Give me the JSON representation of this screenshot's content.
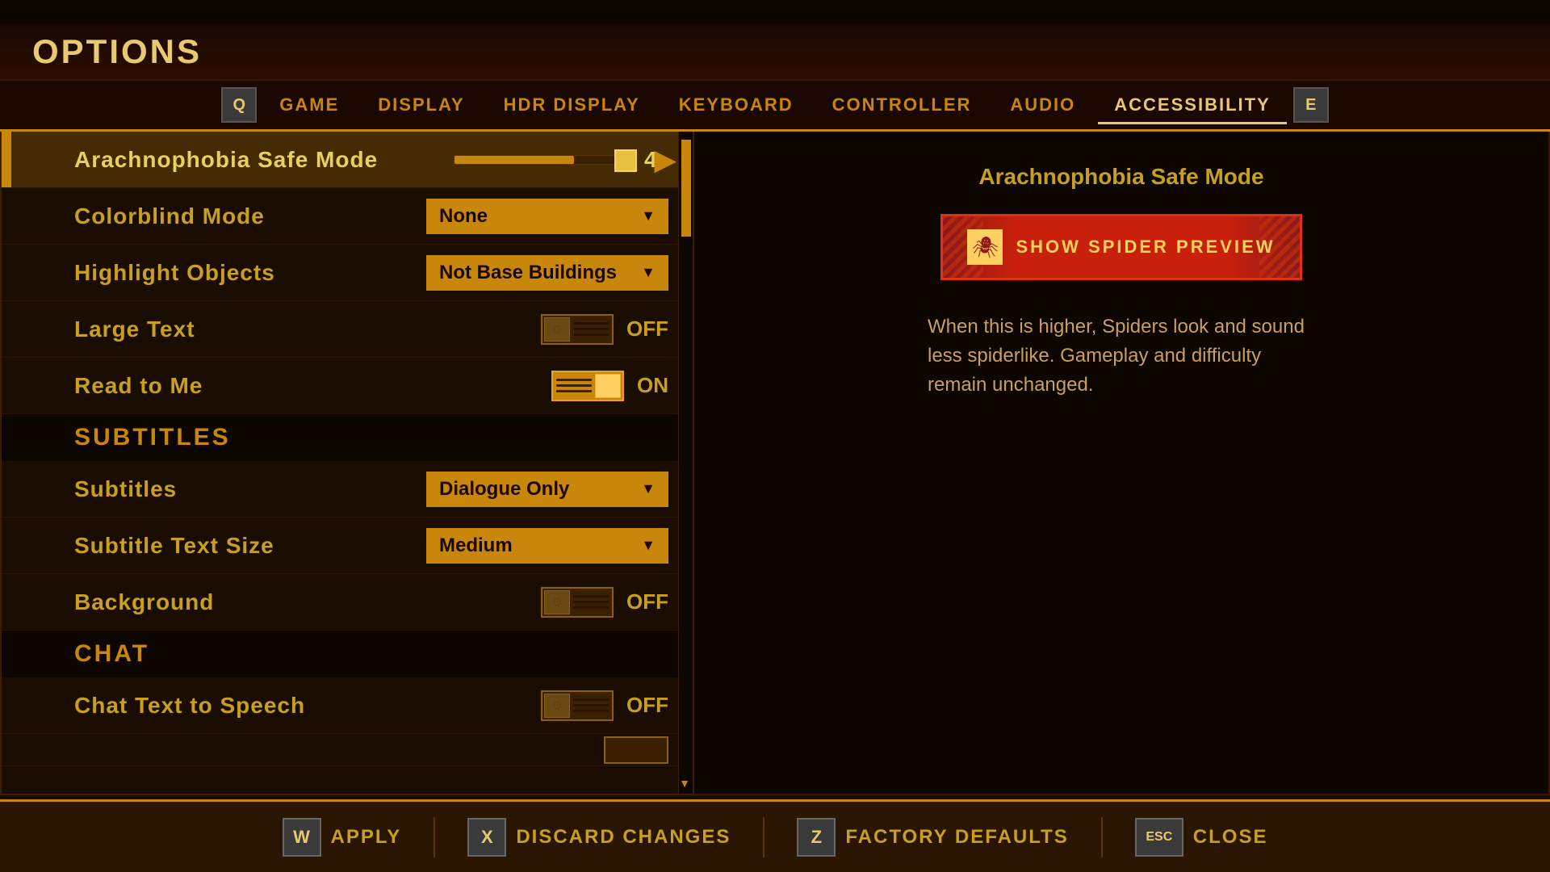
{
  "title": "OPTIONS",
  "nav": {
    "left_icon": "Q",
    "right_icon": "E",
    "tabs": [
      {
        "label": "GAME",
        "active": false
      },
      {
        "label": "DISPLAY",
        "active": false
      },
      {
        "label": "HDR DISPLAY",
        "active": false
      },
      {
        "label": "KEYBOARD",
        "active": false
      },
      {
        "label": "CONTROLLER",
        "active": false
      },
      {
        "label": "AUDIO",
        "active": false
      },
      {
        "label": "ACCESSIBILITY",
        "active": true
      }
    ]
  },
  "settings": {
    "rows": [
      {
        "type": "slider",
        "label": "Arachnophobia Safe Mode",
        "value": 4,
        "max": 10,
        "fill_pct": 68,
        "selected": true
      },
      {
        "type": "dropdown",
        "label": "Colorblind Mode",
        "value": "None"
      },
      {
        "type": "dropdown",
        "label": "Highlight Objects",
        "value": "Not Base Buildings"
      },
      {
        "type": "toggle",
        "label": "Large Text",
        "on": false
      },
      {
        "type": "toggle",
        "label": "Read to Me",
        "on": true
      },
      {
        "type": "section",
        "label": "SUBTITLES"
      },
      {
        "type": "dropdown",
        "label": "Subtitles",
        "value": "Dialogue Only"
      },
      {
        "type": "dropdown",
        "label": "Subtitle Text Size",
        "value": "Medium"
      },
      {
        "type": "toggle",
        "label": "Background",
        "on": false
      },
      {
        "type": "section",
        "label": "CHAT"
      },
      {
        "type": "toggle",
        "label": "Chat Text to Speech",
        "on": false
      }
    ]
  },
  "info_panel": {
    "title": "Arachnophobia Safe Mode",
    "button_label": "SHOW SPIDER PREVIEW",
    "description": "When this is higher, Spiders look and sound less spiderlike. Gameplay and difficulty remain unchanged."
  },
  "bottom_bar": {
    "buttons": [
      {
        "key": "W",
        "label": "APPLY"
      },
      {
        "key": "X",
        "label": "DISCARD CHANGES"
      },
      {
        "key": "Z",
        "label": "FACTORY DEFAULTS"
      },
      {
        "key": "Esc",
        "label": "CLOSE"
      }
    ]
  }
}
